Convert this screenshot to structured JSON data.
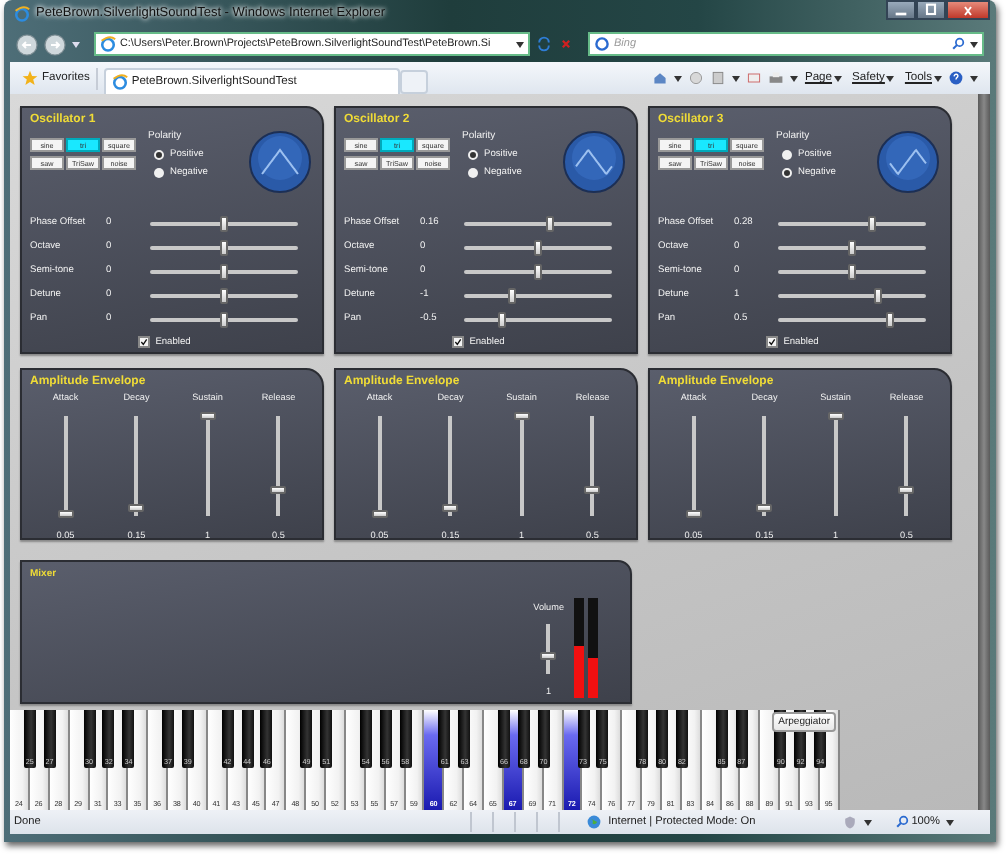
{
  "window": {
    "title": "PeteBrown.SilverlightSoundTest - Windows Internet Explorer",
    "address": "C:\\Users\\Peter.Brown\\Projects\\PeteBrown.SilverlightSoundTest\\PeteBrown.Si",
    "search": {
      "placeholder": "Bing"
    },
    "favorites": "Favorites",
    "tab": "PeteBrown.SilverlightSoundTest",
    "menus": [
      "Page",
      "Safety",
      "Tools"
    ]
  },
  "oscillators": [
    {
      "title": "Oscillator 1",
      "waveforms": [
        {
          "label": "sine",
          "selected": false
        },
        {
          "label": "tri",
          "selected": true
        },
        {
          "label": "square",
          "selected": false
        },
        {
          "label": "saw",
          "selected": false
        },
        {
          "label": "TriSaw",
          "selected": false
        },
        {
          "label": "noise",
          "selected": false
        }
      ],
      "polarity_label": "Polarity",
      "polarity": [
        {
          "label": "Positive",
          "selected": true
        },
        {
          "label": "Negative",
          "selected": false
        }
      ],
      "sliders": [
        {
          "label": "Phase Offset",
          "value": "0",
          "level": 0.5
        },
        {
          "label": "Octave",
          "value": "0",
          "level": 0.5
        },
        {
          "label": "Semi-tone",
          "value": "0",
          "level": 0.5
        },
        {
          "label": "Detune",
          "value": "0",
          "level": 0.5
        },
        {
          "label": "Pan",
          "value": "0",
          "level": 0.5
        }
      ],
      "enabled_label": "Enabled",
      "enabled": true
    },
    {
      "title": "Oscillator 2",
      "waveforms": [
        {
          "label": "sine",
          "selected": false
        },
        {
          "label": "tri",
          "selected": true
        },
        {
          "label": "square",
          "selected": false
        },
        {
          "label": "saw",
          "selected": false
        },
        {
          "label": "TriSaw",
          "selected": false
        },
        {
          "label": "noise",
          "selected": false
        }
      ],
      "polarity_label": "Polarity",
      "polarity": [
        {
          "label": "Positive",
          "selected": true
        },
        {
          "label": "Negative",
          "selected": false
        }
      ],
      "sliders": [
        {
          "label": "Phase Offset",
          "value": "0.16",
          "level": 0.58
        },
        {
          "label": "Octave",
          "value": "0",
          "level": 0.5
        },
        {
          "label": "Semi-tone",
          "value": "0",
          "level": 0.5
        },
        {
          "label": "Detune",
          "value": "-1",
          "level": 0.33
        },
        {
          "label": "Pan",
          "value": "-0.5",
          "level": 0.26
        }
      ],
      "enabled_label": "Enabled",
      "enabled": true
    },
    {
      "title": "Oscillator 3",
      "waveforms": [
        {
          "label": "sine",
          "selected": false
        },
        {
          "label": "tri",
          "selected": true
        },
        {
          "label": "square",
          "selected": false
        },
        {
          "label": "saw",
          "selected": false
        },
        {
          "label": "TriSaw",
          "selected": false
        },
        {
          "label": "noise",
          "selected": false
        }
      ],
      "polarity_label": "Polarity",
      "polarity": [
        {
          "label": "Positive",
          "selected": false
        },
        {
          "label": "Negative",
          "selected": true
        }
      ],
      "sliders": [
        {
          "label": "Phase Offset",
          "value": "0.28",
          "level": 0.64
        },
        {
          "label": "Octave",
          "value": "0",
          "level": 0.5
        },
        {
          "label": "Semi-tone",
          "value": "0",
          "level": 0.5
        },
        {
          "label": "Detune",
          "value": "1",
          "level": 0.67
        },
        {
          "label": "Pan",
          "value": "0.5",
          "level": 0.76
        }
      ],
      "enabled_label": "Enabled",
      "enabled": true
    }
  ],
  "envelopes": [
    {
      "title": "Amplitude Envelope",
      "sliders": [
        {
          "label": "Attack",
          "value": "0.05",
          "level": 0.03
        },
        {
          "label": "Decay",
          "value": "0.15",
          "level": 0.08
        },
        {
          "label": "Sustain",
          "value": "1",
          "level": 1
        },
        {
          "label": "Release",
          "value": "0.5",
          "level": 0.27
        }
      ]
    },
    {
      "title": "Amplitude Envelope",
      "sliders": [
        {
          "label": "Attack",
          "value": "0.05",
          "level": 0.03
        },
        {
          "label": "Decay",
          "value": "0.15",
          "level": 0.08
        },
        {
          "label": "Sustain",
          "value": "1",
          "level": 1
        },
        {
          "label": "Release",
          "value": "0.5",
          "level": 0.27
        }
      ]
    },
    {
      "title": "Amplitude Envelope",
      "sliders": [
        {
          "label": "Attack",
          "value": "0.05",
          "level": 0.03
        },
        {
          "label": "Decay",
          "value": "0.15",
          "level": 0.08
        },
        {
          "label": "Sustain",
          "value": "1",
          "level": 1
        },
        {
          "label": "Release",
          "value": "0.5",
          "level": 0.27
        }
      ]
    }
  ],
  "mixer": {
    "title": "Mixer",
    "volume": {
      "label": "Volume",
      "value": "1",
      "level": 0.35
    },
    "meters": [
      {
        "level": 0.52
      },
      {
        "level": 0.4
      }
    ]
  },
  "keyboard": {
    "tab": "Arpeggiator",
    "keys": [
      {
        "note": "24",
        "kind": "white",
        "pressed": false
      },
      {
        "note": "25",
        "kind": "black",
        "pressed": false
      },
      {
        "note": "26",
        "kind": "white",
        "pressed": false
      },
      {
        "note": "27",
        "kind": "black",
        "pressed": false
      },
      {
        "note": "28",
        "kind": "white",
        "pressed": false
      },
      {
        "note": "29",
        "kind": "white",
        "pressed": false
      },
      {
        "note": "30",
        "kind": "black",
        "pressed": false
      },
      {
        "note": "31",
        "kind": "white",
        "pressed": false
      },
      {
        "note": "32",
        "kind": "black",
        "pressed": false
      },
      {
        "note": "33",
        "kind": "white",
        "pressed": false
      },
      {
        "note": "34",
        "kind": "black",
        "pressed": false
      },
      {
        "note": "35",
        "kind": "white",
        "pressed": false
      },
      {
        "note": "36",
        "kind": "white",
        "pressed": false
      },
      {
        "note": "37",
        "kind": "black",
        "pressed": false
      },
      {
        "note": "38",
        "kind": "white",
        "pressed": false
      },
      {
        "note": "39",
        "kind": "black",
        "pressed": false
      },
      {
        "note": "40",
        "kind": "white",
        "pressed": false
      },
      {
        "note": "41",
        "kind": "white",
        "pressed": false
      },
      {
        "note": "42",
        "kind": "black",
        "pressed": false
      },
      {
        "note": "43",
        "kind": "white",
        "pressed": false
      },
      {
        "note": "44",
        "kind": "black",
        "pressed": false
      },
      {
        "note": "45",
        "kind": "white",
        "pressed": false
      },
      {
        "note": "46",
        "kind": "black",
        "pressed": false
      },
      {
        "note": "47",
        "kind": "white",
        "pressed": false
      },
      {
        "note": "48",
        "kind": "white",
        "pressed": false
      },
      {
        "note": "49",
        "kind": "black",
        "pressed": false
      },
      {
        "note": "50",
        "kind": "white",
        "pressed": false
      },
      {
        "note": "51",
        "kind": "black",
        "pressed": false
      },
      {
        "note": "52",
        "kind": "white",
        "pressed": false
      },
      {
        "note": "53",
        "kind": "white",
        "pressed": false
      },
      {
        "note": "54",
        "kind": "black",
        "pressed": false
      },
      {
        "note": "55",
        "kind": "white",
        "pressed": false
      },
      {
        "note": "56",
        "kind": "black",
        "pressed": false
      },
      {
        "note": "57",
        "kind": "white",
        "pressed": false
      },
      {
        "note": "58",
        "kind": "black",
        "pressed": false
      },
      {
        "note": "59",
        "kind": "white",
        "pressed": false
      },
      {
        "note": "60",
        "kind": "white",
        "pressed": true
      },
      {
        "note": "61",
        "kind": "black",
        "pressed": false
      },
      {
        "note": "62",
        "kind": "white",
        "pressed": false
      },
      {
        "note": "63",
        "kind": "black",
        "pressed": false
      },
      {
        "note": "64",
        "kind": "white",
        "pressed": false
      },
      {
        "note": "65",
        "kind": "white",
        "pressed": false
      },
      {
        "note": "66",
        "kind": "black",
        "pressed": false
      },
      {
        "note": "67",
        "kind": "white",
        "pressed": true
      },
      {
        "note": "68",
        "kind": "black",
        "pressed": false
      },
      {
        "note": "69",
        "kind": "white",
        "pressed": false
      },
      {
        "note": "70",
        "kind": "black",
        "pressed": false
      },
      {
        "note": "71",
        "kind": "white",
        "pressed": false
      },
      {
        "note": "72",
        "kind": "white",
        "pressed": true
      },
      {
        "note": "73",
        "kind": "black",
        "pressed": false
      },
      {
        "note": "74",
        "kind": "white",
        "pressed": false
      },
      {
        "note": "75",
        "kind": "black",
        "pressed": false
      },
      {
        "note": "76",
        "kind": "white",
        "pressed": false
      },
      {
        "note": "77",
        "kind": "white",
        "pressed": false
      },
      {
        "note": "78",
        "kind": "black",
        "pressed": false
      },
      {
        "note": "79",
        "kind": "white",
        "pressed": false
      },
      {
        "note": "80",
        "kind": "black",
        "pressed": false
      },
      {
        "note": "81",
        "kind": "white",
        "pressed": false
      },
      {
        "note": "82",
        "kind": "black",
        "pressed": false
      },
      {
        "note": "83",
        "kind": "white",
        "pressed": false
      },
      {
        "note": "84",
        "kind": "white",
        "pressed": false
      },
      {
        "note": "85",
        "kind": "black",
        "pressed": false
      },
      {
        "note": "86",
        "kind": "white",
        "pressed": false
      },
      {
        "note": "87",
        "kind": "black",
        "pressed": false
      },
      {
        "note": "88",
        "kind": "white",
        "pressed": false
      },
      {
        "note": "89",
        "kind": "white",
        "pressed": false
      },
      {
        "note": "90",
        "kind": "black",
        "pressed": false
      },
      {
        "note": "91",
        "kind": "white",
        "pressed": false
      },
      {
        "note": "92",
        "kind": "black",
        "pressed": false
      },
      {
        "note": "93",
        "kind": "white",
        "pressed": false
      },
      {
        "note": "94",
        "kind": "black",
        "pressed": false
      },
      {
        "note": "95",
        "kind": "white",
        "pressed": false
      }
    ]
  },
  "status_bar": {
    "text": "Done",
    "zone": "Internet | Protected Mode: On",
    "zoom": "100%"
  }
}
